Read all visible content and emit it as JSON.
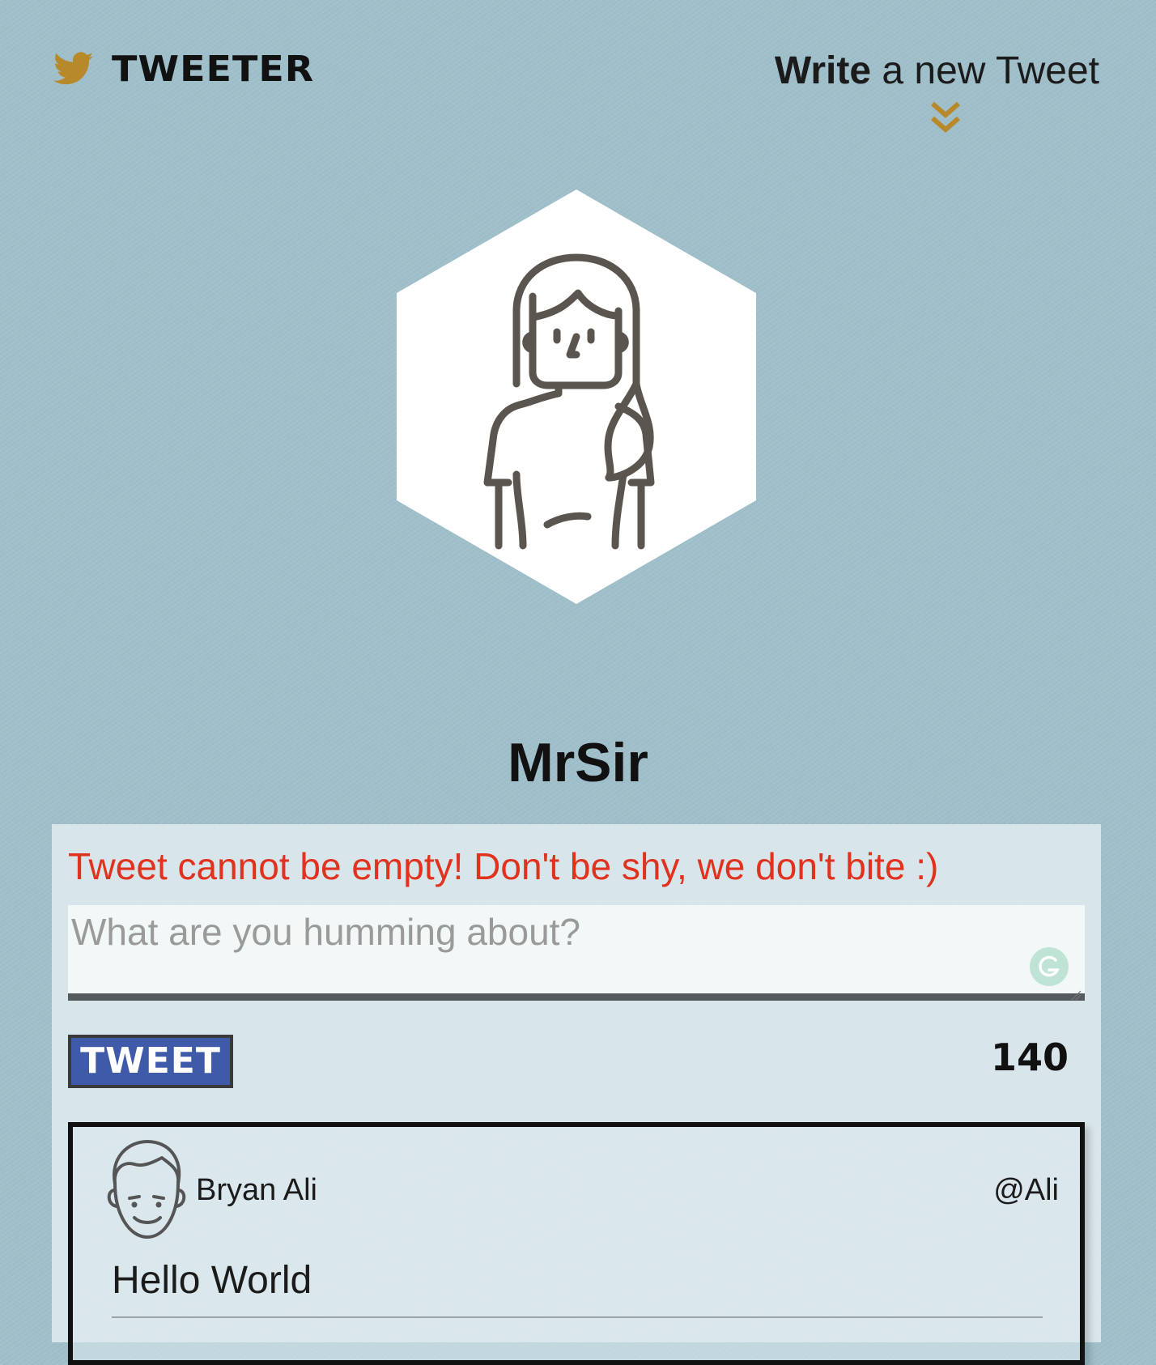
{
  "nav": {
    "brand_name": "TWEETER",
    "brand_icon": "bird-icon",
    "compose_toggle_strong": "Write",
    "compose_toggle_rest": " a new Tweet",
    "compose_toggle_icon": "double-chevron-down-icon"
  },
  "profile": {
    "avatar_icon": "woman-avatar-icon",
    "name": "MrSir"
  },
  "compose": {
    "error_message": "Tweet cannot be empty! Don't be shy, we don't bite :)",
    "input_value": "",
    "input_placeholder": "What are you humming about?",
    "submit_label": "TWEET",
    "char_count": "140",
    "grammarly_icon": "grammarly-icon"
  },
  "tweets": [
    {
      "avatar_icon": "man-avatar-icon",
      "author": "Bryan Ali",
      "handle": "@Ali",
      "text": "Hello World"
    }
  ],
  "colors": {
    "background": "#9fbfca",
    "accent": "#b8892a",
    "error": "#e0321e",
    "button": "#3e5aa8",
    "text": "#111111"
  }
}
